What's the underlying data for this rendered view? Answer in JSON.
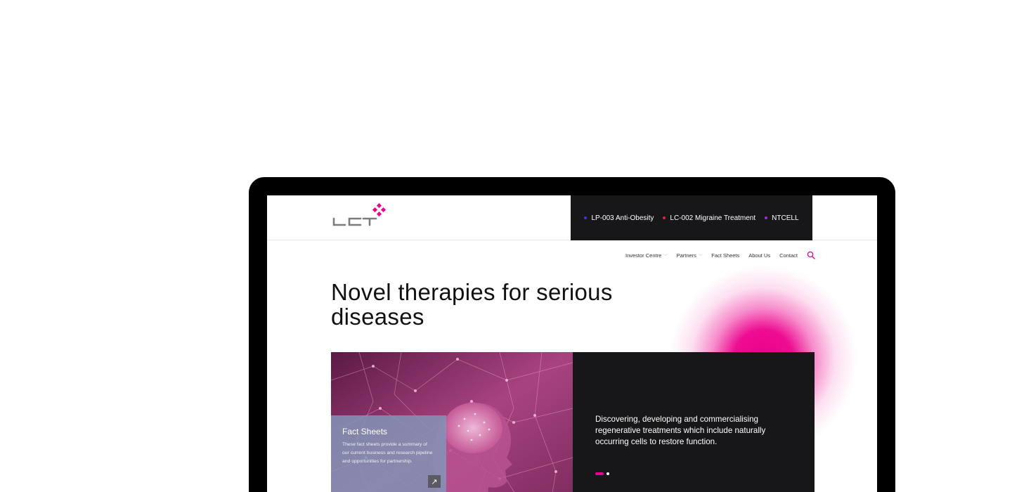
{
  "colors": {
    "accent": "#EC008C",
    "dark": "#17171A",
    "card": "#8494B6"
  },
  "logo": {
    "text": "LCT"
  },
  "pipeline": [
    {
      "label": "LP-003 Anti-Obesity",
      "color": "#2F3CE0"
    },
    {
      "label": "LC-002 Migraine Treatment",
      "color": "#E0233A"
    },
    {
      "label": "NTCELL",
      "color": "#9B2FD0"
    }
  ],
  "nav": {
    "investor": "Investor Centre",
    "partners": "Partners",
    "fact_sheets": "Fact Sheets",
    "about": "About Us",
    "contact": "Contact",
    "search_icon": "search-icon"
  },
  "hero": {
    "headline": "Novel therapies for serious diseases",
    "tagline": "Discovering, developing and commercialising regenerative treatments which include naturally occurring cells to restore function."
  },
  "fact_card": {
    "title": "Fact Sheets",
    "description": "These fact sheets provide a summary of our current business and research pipeline and opportunities for partnership.",
    "arrow_icon": "arrow-up-right-icon"
  },
  "slider": {
    "total": 2,
    "active": 1
  }
}
